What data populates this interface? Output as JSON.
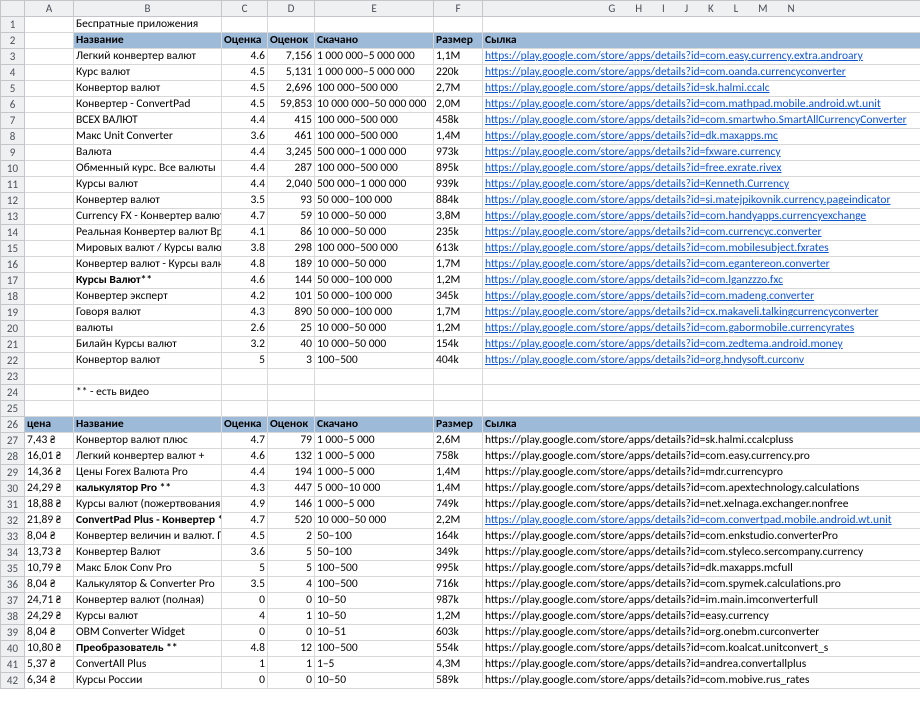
{
  "columns_letters": [
    "A",
    "B",
    "C",
    "D",
    "E",
    "F",
    "G",
    "H",
    "I",
    "J",
    "K",
    "L",
    "M",
    "N"
  ],
  "visible_rows": [
    1,
    2,
    3,
    4,
    5,
    6,
    7,
    8,
    9,
    10,
    11,
    12,
    13,
    14,
    15,
    16,
    17,
    18,
    19,
    20,
    21,
    22,
    23,
    24,
    25,
    26,
    27,
    28,
    29,
    30,
    31,
    32,
    33,
    34,
    35,
    36,
    37,
    38,
    39,
    40,
    41,
    42
  ],
  "title_free": "Беспратные приложения",
  "note_video": "** - есть видео",
  "hdr": {
    "name": "Название",
    "rating": "Оценка",
    "votes": "Оценок",
    "downloads": "Скачано",
    "size": "Размер",
    "url": "Сылка",
    "price": "цена"
  },
  "free": [
    {
      "name": "Легкий конвертер валют",
      "rating": "4.6",
      "votes": "7,156",
      "downloads": "1 000 000–5 000 000",
      "size": "1,1M",
      "url": "https://play.google.com/store/apps/details?id=com.easy.currency.extra.androary",
      "bold": false,
      "linked": true
    },
    {
      "name": "Курс валют",
      "rating": "4.5",
      "votes": "5,131",
      "downloads": "1 000 000–5 000 000",
      "size": "220k",
      "url": "https://play.google.com/store/apps/details?id=com.oanda.currencyconverter",
      "bold": false,
      "linked": true
    },
    {
      "name": "Конвертор валют",
      "rating": "4.5",
      "votes": "2,696",
      "downloads": "100 000–500 000",
      "size": "2,7M",
      "url": "https://play.google.com/store/apps/details?id=sk.halmi.ccalc",
      "bold": false,
      "linked": true
    },
    {
      "name": "Конвертер - ConvertPad",
      "rating": "4.5",
      "votes": "59,853",
      "downloads": "10 000 000–50 000 000",
      "size": "2,0M",
      "url": "https://play.google.com/store/apps/details?id=com.mathpad.mobile.android.wt.unit",
      "bold": false,
      "linked": true
    },
    {
      "name": "ВСЕХ ВАЛЮТ",
      "rating": "4.4",
      "votes": "415",
      "downloads": "100 000–500 000",
      "size": "458k",
      "url": "https://play.google.com/store/apps/details?id=com.smartwho.SmartAllCurrencyConverter",
      "bold": false,
      "linked": true
    },
    {
      "name": "Макс Unit Converter",
      "rating": "3.6",
      "votes": "461",
      "downloads": "100 000–500 000",
      "size": "1,4M",
      "url": "https://play.google.com/store/apps/details?id=dk.maxapps.mc",
      "bold": false,
      "linked": true
    },
    {
      "name": "Валюта",
      "rating": "4.4",
      "votes": "3,245",
      "downloads": "500 000–1 000 000",
      "size": "973k",
      "url": "https://play.google.com/store/apps/details?id=fxware.currency",
      "bold": false,
      "linked": true
    },
    {
      "name": "Обменный курс. Все валюты",
      "rating": "4.4",
      "votes": "287",
      "downloads": "100 000–500 000",
      "size": "895k",
      "url": "https://play.google.com/store/apps/details?id=free.exrate.rivex",
      "bold": false,
      "linked": true
    },
    {
      "name": "Курсы валют",
      "rating": "4.4",
      "votes": "2,040",
      "downloads": "500 000–1 000 000",
      "size": "939k",
      "url": "https://play.google.com/store/apps/details?id=Kenneth.Currency",
      "bold": false,
      "linked": true
    },
    {
      "name": "Конвертер валют",
      "rating": "3.5",
      "votes": "93",
      "downloads": "50 000–100 000",
      "size": "884k",
      "url": "https://play.google.com/store/apps/details?id=si.matejpikovnik.currency.pageindicator",
      "bold": false,
      "linked": true
    },
    {
      "name": "Currency FX - Конвертер валют",
      "rating": "4.7",
      "votes": "59",
      "downloads": "10 000–50 000",
      "size": "3,8M",
      "url": "https://play.google.com/store/apps/details?id=com.handyapps.currencyexchange",
      "bold": false,
      "linked": true
    },
    {
      "name": "Реальная Конвертер валют Вр",
      "rating": "4.1",
      "votes": "86",
      "downloads": "10 000–50 000",
      "size": "235k",
      "url": "https://play.google.com/store/apps/details?id=com.currencyc.converter",
      "bold": false,
      "linked": true
    },
    {
      "name": "Мировых валют / Курсы валют",
      "rating": "3.8",
      "votes": "298",
      "downloads": "100 000–500 000",
      "size": "613k",
      "url": "https://play.google.com/store/apps/details?id=com.mobilesubject.fxrates",
      "bold": false,
      "linked": true
    },
    {
      "name": "Конвертер валют - Курсы валю",
      "rating": "4.8",
      "votes": "189",
      "downloads": "10 000–50 000",
      "size": "1,7M",
      "url": "https://play.google.com/store/apps/details?id=com.egantereon.converter",
      "bold": false,
      "linked": true
    },
    {
      "name": "Курсы Валют**",
      "rating": "4.6",
      "votes": "144",
      "downloads": "50 000–100 000",
      "size": "1,2M",
      "url": "https://play.google.com/store/apps/details?id=com.lganzzzo.fxc",
      "bold": true,
      "linked": true
    },
    {
      "name": "Конвертер эксперт",
      "rating": "4.2",
      "votes": "101",
      "downloads": "50 000–100 000",
      "size": "345k",
      "url": "https://play.google.com/store/apps/details?id=com.madeng.converter",
      "bold": false,
      "linked": true
    },
    {
      "name": "Говоря валют",
      "rating": "4.3",
      "votes": "890",
      "downloads": "50 000–100 000",
      "size": "1,7M",
      "url": "https://play.google.com/store/apps/details?id=cx.makaveli.talkingcurrencyconverter",
      "bold": false,
      "linked": true
    },
    {
      "name": "валюты",
      "rating": "2.6",
      "votes": "25",
      "downloads": "10 000–50 000",
      "size": "1,2M",
      "url": "https://play.google.com/store/apps/details?id=com.gabormobile.currencyrates",
      "bold": false,
      "linked": true
    },
    {
      "name": "Билайн Курсы валют",
      "rating": "3.2",
      "votes": "40",
      "downloads": "10 000–50 000",
      "size": "154k",
      "url": "https://play.google.com/store/apps/details?id=com.zedtema.android.money",
      "bold": false,
      "linked": true
    },
    {
      "name": "Конвертор валют",
      "rating": "5",
      "votes": "3",
      "downloads": "100–500",
      "size": "404k",
      "url": "https://play.google.com/store/apps/details?id=org.hndysoft.curconv",
      "bold": false,
      "linked": true
    }
  ],
  "paid": [
    {
      "price": "7,43 ₴",
      "name": "Конвертор валют плюс",
      "rating": "4.7",
      "votes": "79",
      "downloads": "1 000–5 000",
      "size": "2,6M",
      "url": "https://play.google.com/store/apps/details?id=sk.halmi.ccalcpluss",
      "bold": false,
      "linked": false
    },
    {
      "price": "16,01 ₴",
      "name": "Легкий конвертер валют +",
      "rating": "4.6",
      "votes": "132",
      "downloads": "1 000–5 000",
      "size": "758k",
      "url": "https://play.google.com/store/apps/details?id=com.easy.currency.pro",
      "bold": false,
      "linked": false
    },
    {
      "price": "14,36 ₴",
      "name": "Цены Forex Валюта Pro",
      "rating": "4.4",
      "votes": "194",
      "downloads": "1 000–5 000",
      "size": "1,4M",
      "url": "https://play.google.com/store/apps/details?id=mdr.currencypro",
      "bold": false,
      "linked": false
    },
    {
      "price": "24,29 ₴",
      "name": "калькулятор Pro **",
      "rating": "4.3",
      "votes": "447",
      "downloads": "5 000–10 000",
      "size": "1,4M",
      "url": "https://play.google.com/store/apps/details?id=com.apextechnology.calculations",
      "bold": true,
      "linked": false
    },
    {
      "price": "18,88 ₴",
      "name": "Курсы валют (пожертвования)",
      "rating": "4.9",
      "votes": "146",
      "downloads": "1 000–5 000",
      "size": "749k",
      "url": "https://play.google.com/store/apps/details?id=net.xelnaga.exchanger.nonfree",
      "bold": false,
      "linked": false
    },
    {
      "price": "21,89 ₴",
      "name": "ConvertPad Plus - Конвертер *",
      "rating": "4.7",
      "votes": "520",
      "downloads": "10 000–50 000",
      "size": "2,2M",
      "url": "https://play.google.com/store/apps/details?id=com.convertpad.mobile.android.wt.unit",
      "bold": true,
      "linked": true
    },
    {
      "price": "8,04 ₴",
      "name": "Конвертер величин и валют. П",
      "rating": "4.5",
      "votes": "2",
      "downloads": "50–100",
      "size": "164k",
      "url": "https://play.google.com/store/apps/details?id=com.enkstudio.converterPro",
      "bold": false,
      "linked": false
    },
    {
      "price": "13,73 ₴",
      "name": "Конвертер Валют",
      "rating": "3.6",
      "votes": "5",
      "downloads": "50–100",
      "size": "349k",
      "url": "https://play.google.com/store/apps/details?id=com.styleco.sercompany.currency",
      "bold": false,
      "linked": false
    },
    {
      "price": "10,79 ₴",
      "name": "Макс Блок Conv Pro",
      "rating": "5",
      "votes": "5",
      "downloads": "100–500",
      "size": "995k",
      "url": "https://play.google.com/store/apps/details?id=dk.maxapps.mcfull",
      "bold": false,
      "linked": false
    },
    {
      "price": "8,04 ₴",
      "name": "Калькулятор & Converter Pro",
      "rating": "3.5",
      "votes": "4",
      "downloads": "100–500",
      "size": "716k",
      "url": "https://play.google.com/store/apps/details?id=com.spymek.calculations.pro",
      "bold": false,
      "linked": false
    },
    {
      "price": "24,71 ₴",
      "name": "Конвертер валют (полная)",
      "rating": "0",
      "votes": "0",
      "downloads": "10–50",
      "size": "987k",
      "url": "https://play.google.com/store/apps/details?id=im.main.imconverterfull",
      "bold": false,
      "linked": false
    },
    {
      "price": "24,29 ₴",
      "name": "Курсы валют",
      "rating": "4",
      "votes": "1",
      "downloads": "10–50",
      "size": "1,2M",
      "url": "https://play.google.com/store/apps/details?id=easy.currency",
      "bold": false,
      "linked": false
    },
    {
      "price": "8,04 ₴",
      "name": "OBM Converter Widget",
      "rating": "0",
      "votes": "0",
      "downloads": "10–51",
      "size": "603k",
      "url": "https://play.google.com/store/apps/details?id=org.onebm.curconverter",
      "bold": false,
      "linked": false
    },
    {
      "price": "10,80 ₴",
      "name": "Преобразователь **",
      "rating": "4.8",
      "votes": "12",
      "downloads": "100–500",
      "size": "554k",
      "url": "https://play.google.com/store/apps/details?id=com.koalcat.unitconvert_s",
      "bold": true,
      "linked": false
    },
    {
      "price": "5,37 ₴",
      "name": "ConvertAll Plus",
      "rating": "1",
      "votes": "1",
      "downloads": "1–5",
      "size": "4,3M",
      "url": "https://play.google.com/store/apps/details?id=andrea.convertallplus",
      "bold": false,
      "linked": false
    },
    {
      "price": "6,34 ₴",
      "name": "Курсы России",
      "rating": "0",
      "votes": "0",
      "downloads": "10–50",
      "size": "589k",
      "url": "https://play.google.com/store/apps/details?id=com.mobive.rus_rates",
      "bold": false,
      "linked": false
    }
  ]
}
